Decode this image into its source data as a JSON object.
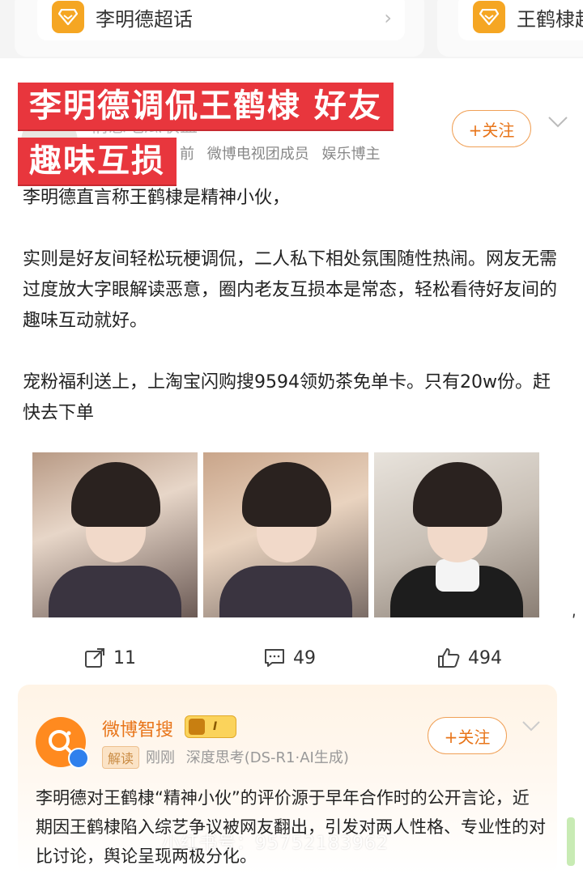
{
  "topics": [
    {
      "label": "李明德超话",
      "chevron": "›"
    },
    {
      "label": "王鹤棣超"
    }
  ],
  "banner": {
    "line1": "李明德调侃王鹤棣 好友",
    "line2": "趣味互损"
  },
  "post": {
    "author": "情感吃瓜联盟",
    "meta": [
      "前",
      "微博电视团成员",
      "娱乐博主"
    ],
    "follow_label": "+关注",
    "body": {
      "p1": "李明德直言称王鹤棣是精神小伙，",
      "p2": "实则是好友间轻松玩梗调侃，二人私下相处氛围随性热闹。网友无需过度放大字眼解读恶意，圈内老友互损本是常态，轻松看待好友间的趣味互动就好。",
      "p3": "宠粉福利送上，上淘宝闪购搜9594领奶茶免单卡。只有20w份。赶快去下单"
    },
    "actions": {
      "repost": "11",
      "comment": "49",
      "like": "494"
    }
  },
  "ai_card": {
    "name": "微博智搜",
    "rank": "I",
    "tag": "解读",
    "meta": [
      "刚刚",
      "深度思考(DS-R1·AI生成)"
    ],
    "follow_label": "+关注",
    "text": "李明德对王鹤棣“精神小伙”的评价源于早年合作时的公开言论，近期因王鹤棣陷入综艺争议被网友翻出，引发对两人性格、专业性的对比讨论，舆论呈现两极分化。"
  },
  "watermark": "小红书号：95752183962",
  "colors": {
    "accent": "#e8751a",
    "banner": "#e8363d",
    "verified": "#2f80ed"
  }
}
